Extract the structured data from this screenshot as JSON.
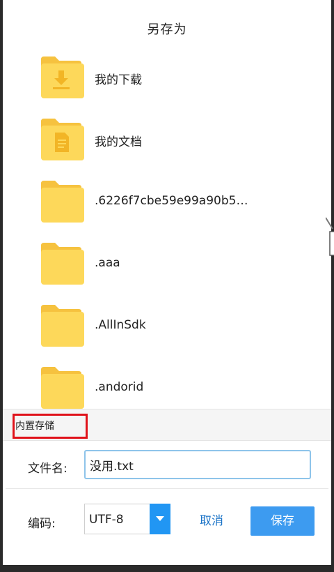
{
  "dialog": {
    "title": "另存为"
  },
  "folders": [
    {
      "label": "我的下载",
      "icon": "download-folder-icon"
    },
    {
      "label": "我的文档",
      "icon": "document-folder-icon"
    },
    {
      "label": ".6226f7cbe59e99a90b5…",
      "icon": "folder-icon"
    },
    {
      "label": ".aaa",
      "icon": "folder-icon"
    },
    {
      "label": ".AllInSdk",
      "icon": "folder-icon"
    },
    {
      "label": ".andorid",
      "icon": "folder-icon"
    }
  ],
  "storage": {
    "label": "内置存储"
  },
  "filename": {
    "label": "文件名:",
    "value": "没用.txt"
  },
  "encoding": {
    "label": "编码:",
    "selected": "UTF-8"
  },
  "actions": {
    "cancel_label": "取消",
    "save_label": "保存"
  },
  "colors": {
    "folder_body": "#fdd85a",
    "folder_tab": "#f6c23f",
    "folder_glyph": "#f2b526",
    "accent": "#2196f3",
    "highlight_box": "#e0121a"
  }
}
